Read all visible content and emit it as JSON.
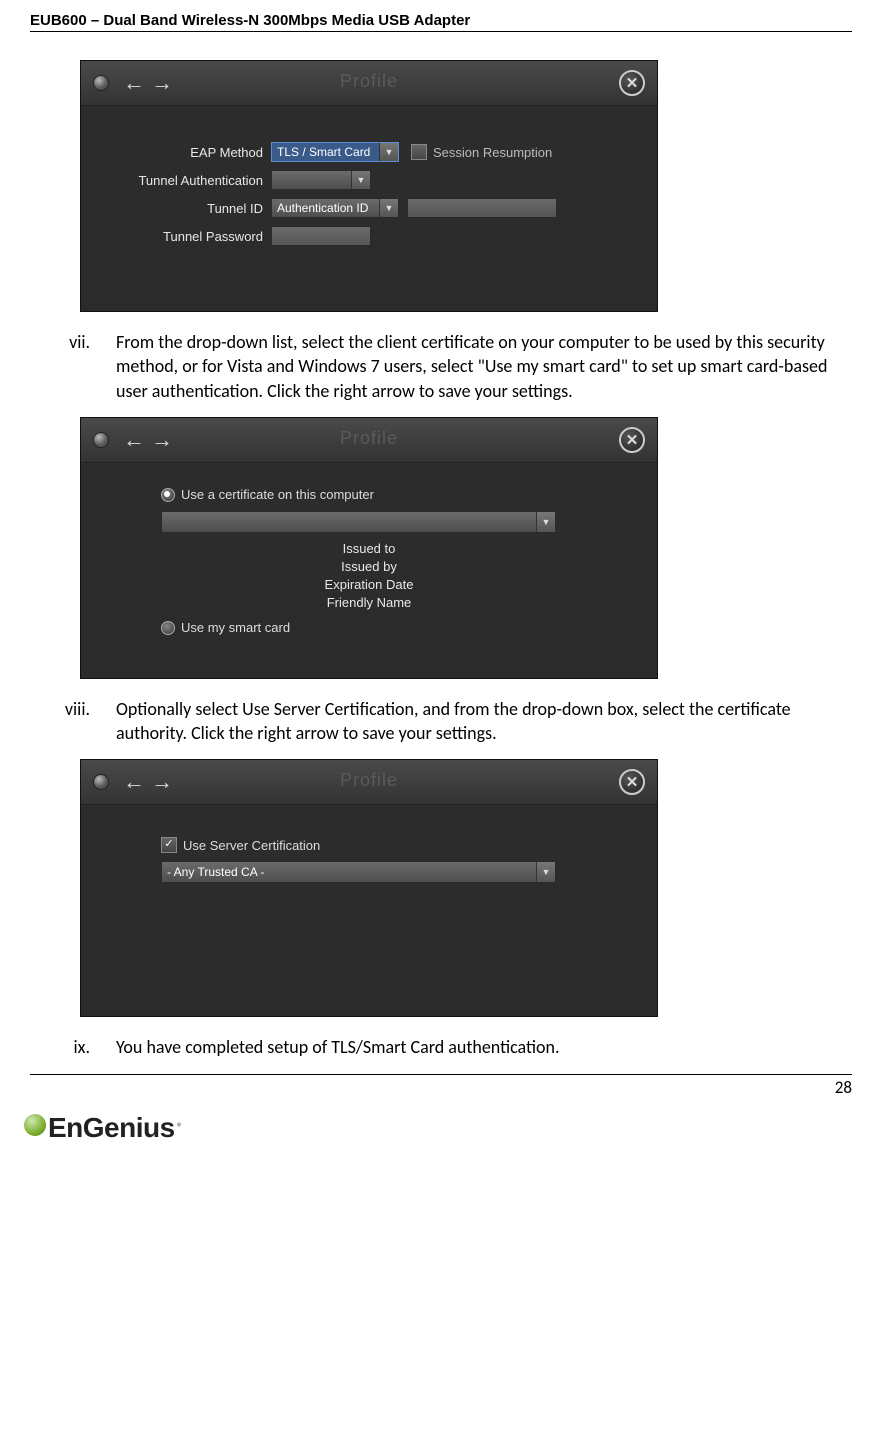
{
  "header": "EUB600 – Dual Band Wireless-N 300Mbps Media USB Adapter",
  "page_number": "28",
  "logo": "EnGenius",
  "profile_title": "Profile",
  "steps": {
    "vii": {
      "num": "vii.",
      "text": "From the drop-down list, select the client certificate on your computer to be used by this security method, or for Vista and Windows 7 users, select \"Use my smart card\" to set up smart card-based user authentication. Click the right arrow to save your settings."
    },
    "viii": {
      "num": "viii.",
      "text": "Optionally select Use Server Certification, and from the drop-down box, select the certificate authority. Click the right arrow to save your settings."
    },
    "ix": {
      "num": "ix.",
      "text": "You have completed setup of TLS/Smart Card authentication."
    }
  },
  "box1": {
    "eap_label": "EAP Method",
    "eap_value": "TLS / Smart Card",
    "session_resumption": "Session Resumption",
    "tunnel_auth_label": "Tunnel Authentication",
    "tunnel_id_label": "Tunnel ID",
    "tunnel_id_value": "Authentication ID",
    "tunnel_pw_label": "Tunnel Password"
  },
  "box2": {
    "use_cert": "Use a certificate on this computer",
    "issued_to": "Issued to",
    "issued_by": "Issued by",
    "expiration": "Expiration Date",
    "friendly": "Friendly Name",
    "use_smart": "Use my smart card"
  },
  "box3": {
    "use_server": "Use Server Certification",
    "ca_value": "- Any Trusted CA -"
  }
}
